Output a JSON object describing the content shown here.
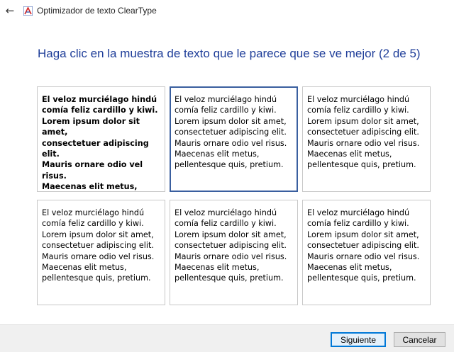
{
  "window": {
    "title": "Optimizador de texto ClearType",
    "back_icon": "←",
    "app_icon": "cleartype-A-icon"
  },
  "heading": "Haga clic en la muestra de texto que le parece que se ve mejor (2 de 5)",
  "samples": [
    {
      "text": "El veloz murciélago hindú\ncomía feliz cardillo y kiwi.\nLorem ipsum dolor sit amet,\nconsectetuer adipiscing elit.\nMauris ornare odio vel risus.\nMaecenas elit metus,\npellentesque quis, pretium.",
      "selected": false
    },
    {
      "text": "El veloz murciélago hindú\ncomía feliz cardillo y kiwi.\nLorem ipsum dolor sit amet,\nconsectetuer adipiscing elit.\nMauris ornare odio vel risus.\nMaecenas elit metus,\npellentesque quis, pretium.",
      "selected": true
    },
    {
      "text": "El veloz murciélago hindú\ncomía feliz cardillo y kiwi.\nLorem ipsum dolor sit amet,\nconsectetuer adipiscing elit.\nMauris ornare odio vel risus.\nMaecenas elit metus,\npellentesque quis, pretium.",
      "selected": false
    },
    {
      "text": "El veloz murciélago hindú\ncomía feliz cardillo y kiwi.\nLorem ipsum dolor sit amet,\nconsectetuer adipiscing elit.\nMauris ornare odio vel risus.\nMaecenas elit metus,\npellentesque quis, pretium.",
      "selected": false
    },
    {
      "text": "El veloz murciélago hindú\ncomía feliz cardillo y kiwi.\nLorem ipsum dolor sit amet,\nconsectetuer adipiscing elit.\nMauris ornare odio vel risus.\nMaecenas elit metus,\npellentesque quis, pretium.",
      "selected": false
    },
    {
      "text": "El veloz murciélago hindú\ncomía feliz cardillo y kiwi.\nLorem ipsum dolor sit amet,\nconsectetuer adipiscing elit.\nMauris ornare odio vel risus.\nMaecenas elit metus,\npellentesque quis, pretium.",
      "selected": false
    }
  ],
  "buttons": {
    "next_label": "Siguiente",
    "cancel_label": "Cancelar"
  },
  "colors": {
    "heading": "#1f3e99",
    "selected_border": "#3a5f9f",
    "default_button_border": "#0078d7"
  }
}
